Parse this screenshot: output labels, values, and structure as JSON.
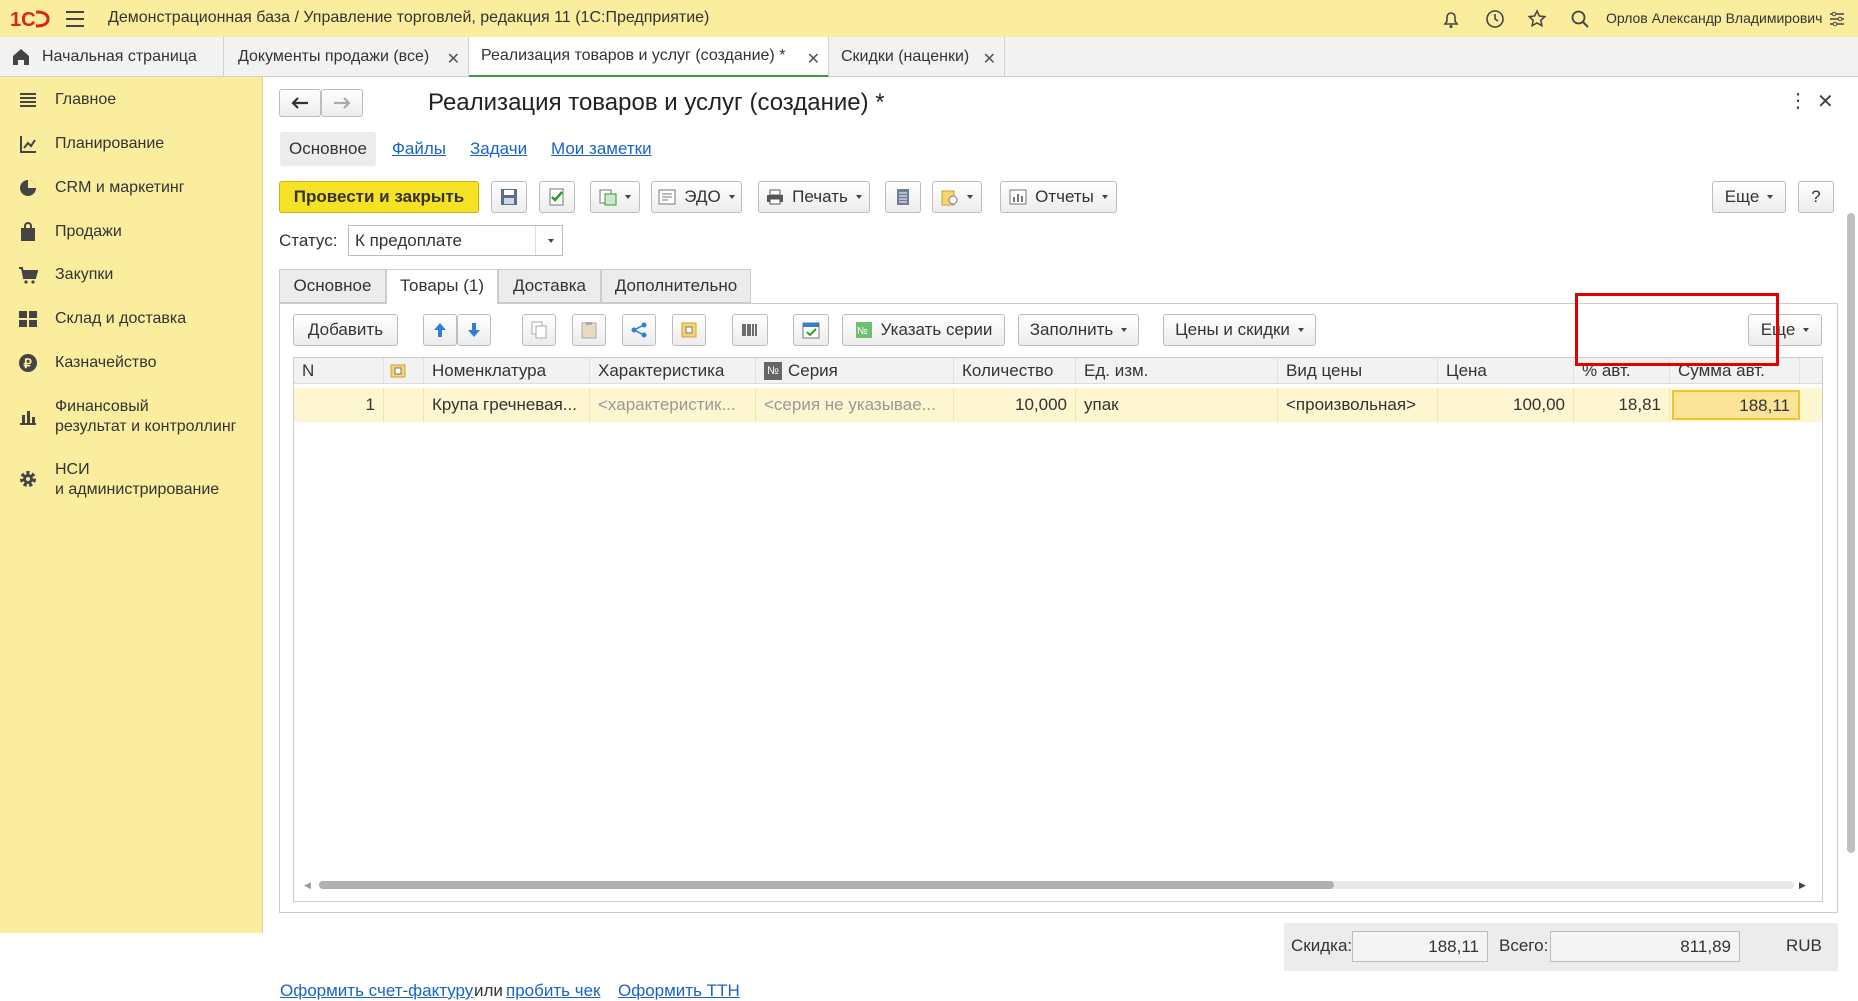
{
  "app": {
    "title": "Демонстрационная база / Управление торговлей, редакция 11   (1С:Предприятие)",
    "user": "Орлов Александр Владимирович"
  },
  "tabs": [
    {
      "label": "Начальная страница"
    },
    {
      "label": "Документы продажи (все)"
    },
    {
      "label": "Реализация товаров и услуг (создание) *"
    },
    {
      "label": "Скидки (наценки)"
    }
  ],
  "sidebar": {
    "items": [
      {
        "label": "Главное",
        "icon": "list-icon"
      },
      {
        "label": "Планирование",
        "icon": "planning-icon"
      },
      {
        "label": "CRM и маркетинг",
        "icon": "pie-icon"
      },
      {
        "label": "Продажи",
        "icon": "bag-icon"
      },
      {
        "label": "Закупки",
        "icon": "cart-icon"
      },
      {
        "label": "Склад и доставка",
        "icon": "grid-icon"
      },
      {
        "label": "Казначейство",
        "icon": "ruble-icon"
      },
      {
        "label": "Финансовый",
        "label2": "результат и контроллинг",
        "icon": "barchart-icon"
      },
      {
        "label": "НСИ",
        "label2": "и администрирование",
        "icon": "gear-icon"
      }
    ]
  },
  "form": {
    "title": "Реализация товаров и услуг (создание) *",
    "nav": {
      "main": "Основное",
      "files": "Файлы",
      "tasks": "Задачи",
      "notes": "Мои заметки"
    },
    "toolbar": {
      "post_close": "Провести и закрыть",
      "edo": "ЭДО",
      "print": "Печать",
      "reports": "Отчеты",
      "more": "Еще",
      "help": "?"
    },
    "status": {
      "label": "Статус:",
      "value": "К предоплате"
    },
    "subtabs": [
      "Основное",
      "Товары (1)",
      "Доставка",
      "Дополнительно"
    ],
    "grid_toolbar": {
      "add": "Добавить",
      "series": "Указать серии",
      "fill": "Заполнить",
      "prices": "Цены и скидки",
      "more": "Еще"
    },
    "columns": [
      "N",
      "Номенклатура",
      "Характеристика",
      "Серия",
      "Количество",
      "Ед. изм.",
      "Вид цены",
      "Цена",
      "% авт.",
      "Сумма авт."
    ],
    "rows": [
      {
        "n": "1",
        "item": "Крупа гречневая...",
        "char": "<характеристик...",
        "series": "<серия не указывае...",
        "qty": "10,000",
        "unit": "упак",
        "price_type": "<произвольная>",
        "price": "100,00",
        "pct": "18,81",
        "sum": "188,11"
      }
    ],
    "totals": {
      "discount_label": "Скидка:",
      "discount": "188,11",
      "total_label": "Всего:",
      "total": "811,89",
      "currency": "RUB"
    },
    "footer": {
      "invoice": "Оформить счет-фактуру",
      "or": "или",
      "receipt": "пробить чек",
      "ttn": "Оформить ТТН"
    }
  },
  "colors": {
    "accent": "#fbed9e",
    "primary_button": "#f6e225",
    "link": "#1a62c8",
    "highlight": "#e30000"
  }
}
